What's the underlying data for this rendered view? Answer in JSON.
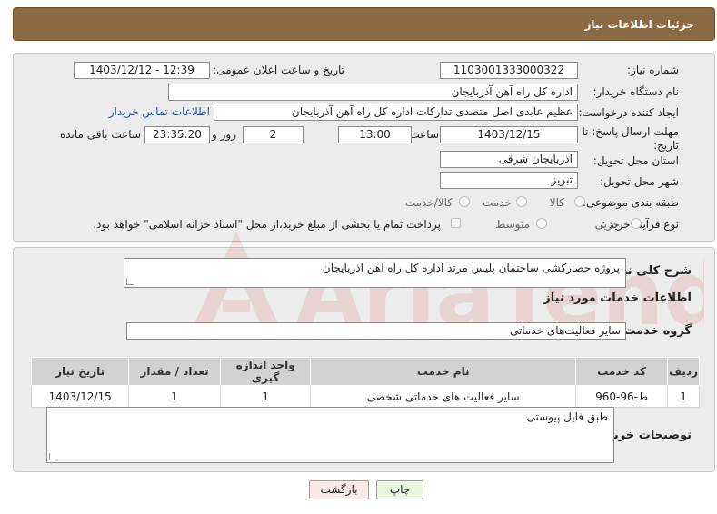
{
  "header": {
    "title": "جزئیات اطلاعات نیاز"
  },
  "form": {
    "need_number": {
      "label": "شماره نیاز:",
      "value": "1103001333000322"
    },
    "announce_datetime": {
      "label": "تاریخ و ساعت اعلان عمومی:",
      "value": "1403/12/12 - 12:39"
    },
    "buyer_org": {
      "label": "نام دستگاه خریدار:",
      "value": "اداره کل راه آهن آذربایجان"
    },
    "requester": {
      "label": "ایجاد کننده درخواست:",
      "value": "عظیم عابدی اصل متصدی تدارکات اداره کل راه آهن آذربایجان",
      "contact_link": "اطلاعات تماس خریدار"
    },
    "deadline": {
      "label_line1": "مهلت ارسال پاسخ: تا",
      "label_line2": "تاریخ:",
      "date": "1403/12/15",
      "time_label": "ساعت",
      "time": "13:00",
      "days": "2",
      "days_label": "روز و",
      "remaining": "23:35:20",
      "remaining_label": "ساعت باقی مانده"
    },
    "province": {
      "label": "استان محل تحویل:",
      "value": "آذربایجان شرقی"
    },
    "city": {
      "label": "شهر محل تحویل:",
      "value": "تبریز"
    },
    "category": {
      "label": "طبقه بندی موضوعی:",
      "options": [
        "کالا",
        "خدمت",
        "کالا/خدمت"
      ]
    },
    "process_type": {
      "label": "نوع فرآیند خرید :",
      "options": [
        "جزیی",
        "متوسط"
      ],
      "payment_note": "پرداخت تمام یا بخشی از مبلغ خرید،از محل \"اسناد خزانه اسلامی\" خواهد بود."
    }
  },
  "details": {
    "general_desc_label": "شرح کلی نیاز:",
    "general_desc": "پروژه حصارکشی ساختمان پلیس مرتد اداره کل راه آهن آذربایجان",
    "services_info_title": "اطلاعات خدمات مورد نیاز",
    "service_group_label": "گروه خدمت:",
    "service_group": "سایر فعالیت‌های خدماتی",
    "table": {
      "headers": [
        "ردیف",
        "کد خدمت",
        "نام خدمت",
        "واحد اندازه گیری",
        "تعداد / مقدار",
        "تاریخ نیاز"
      ],
      "rows": [
        [
          "1",
          "ط-96-960",
          "سایر فعالیت های خدماتی شخصی",
          "1",
          "1",
          "1403/12/15"
        ]
      ]
    },
    "buyer_notes_label": "توضیحات خریدار:",
    "buyer_notes": "طبق فایل پیوستی"
  },
  "buttons": {
    "print": "چاپ",
    "back": "بازگشت"
  },
  "watermark_text": "AriaTender.net",
  "colors": {
    "header_bg": "#8b6a43",
    "link": "#1f4fa8"
  }
}
